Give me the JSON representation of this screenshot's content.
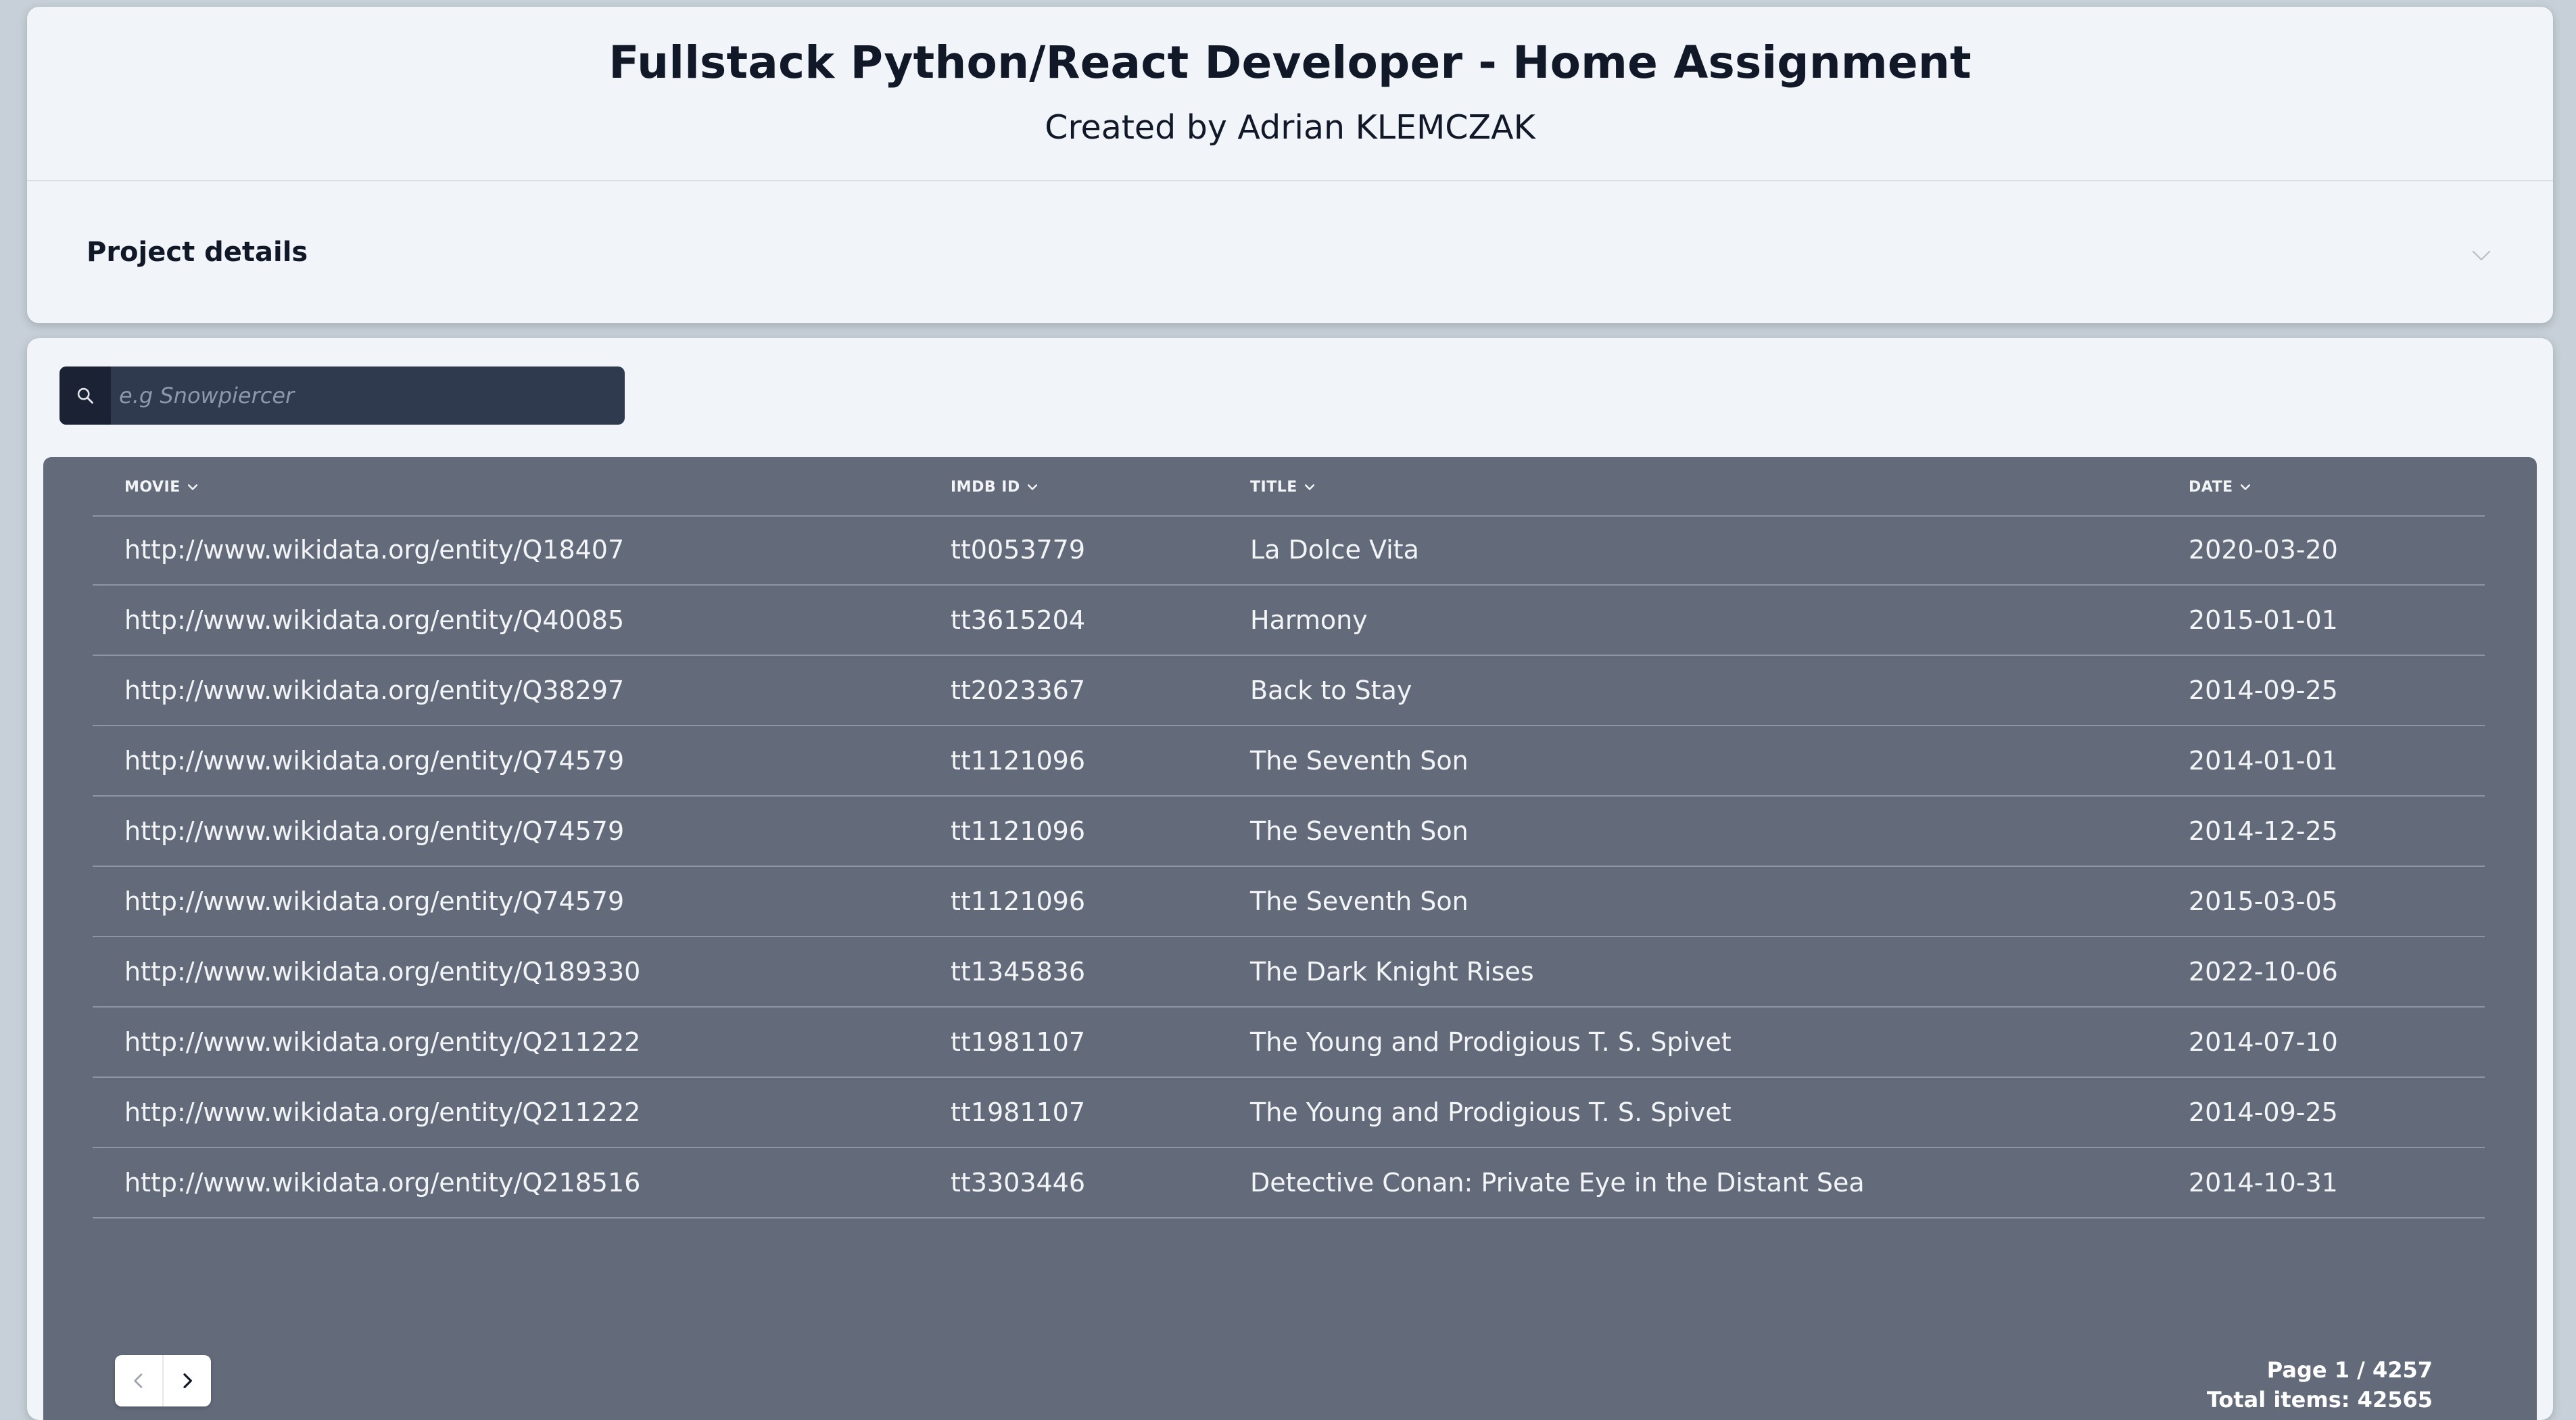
{
  "header": {
    "title": "Fullstack Python/React Developer - Home Assignment",
    "subtitle": "Created by Adrian KLEMCZAK",
    "project_details_label": "Project details"
  },
  "search": {
    "placeholder": "e.g Snowpiercer",
    "value": ""
  },
  "table": {
    "columns": [
      "MOVIE",
      "IMDB ID",
      "TITLE",
      "DATE"
    ],
    "rows": [
      {
        "movie": "http://www.wikidata.org/entity/Q18407",
        "imdb_id": "tt0053779",
        "title": "La Dolce Vita",
        "date": "2020-03-20"
      },
      {
        "movie": "http://www.wikidata.org/entity/Q40085",
        "imdb_id": "tt3615204",
        "title": "Harmony",
        "date": "2015-01-01"
      },
      {
        "movie": "http://www.wikidata.org/entity/Q38297",
        "imdb_id": "tt2023367",
        "title": "Back to Stay",
        "date": "2014-09-25"
      },
      {
        "movie": "http://www.wikidata.org/entity/Q74579",
        "imdb_id": "tt1121096",
        "title": "The Seventh Son",
        "date": "2014-01-01"
      },
      {
        "movie": "http://www.wikidata.org/entity/Q74579",
        "imdb_id": "tt1121096",
        "title": "The Seventh Son",
        "date": "2014-12-25"
      },
      {
        "movie": "http://www.wikidata.org/entity/Q74579",
        "imdb_id": "tt1121096",
        "title": "The Seventh Son",
        "date": "2015-03-05"
      },
      {
        "movie": "http://www.wikidata.org/entity/Q189330",
        "imdb_id": "tt1345836",
        "title": "The Dark Knight Rises",
        "date": "2022-10-06"
      },
      {
        "movie": "http://www.wikidata.org/entity/Q211222",
        "imdb_id": "tt1981107",
        "title": "The Young and Prodigious T. S. Spivet",
        "date": "2014-07-10"
      },
      {
        "movie": "http://www.wikidata.org/entity/Q211222",
        "imdb_id": "tt1981107",
        "title": "The Young and Prodigious T. S. Spivet",
        "date": "2014-09-25"
      },
      {
        "movie": "http://www.wikidata.org/entity/Q218516",
        "imdb_id": "tt3303446",
        "title": "Detective Conan: Private Eye in the Distant Sea",
        "date": "2014-10-31"
      }
    ]
  },
  "pagination": {
    "page_text": "Page 1 / 4257",
    "total_text": "Total items: 42565"
  },
  "icons": {
    "search": "search-icon",
    "project_toggle": "chevron-down-icon",
    "sort": "chevron-down-icon",
    "prev": "chevron-left-icon",
    "next": "chevron-right-icon"
  },
  "colors": {
    "table_background": "#636b7b",
    "search_background": "#2f3a4f",
    "card_background": "#f1f5f9"
  }
}
